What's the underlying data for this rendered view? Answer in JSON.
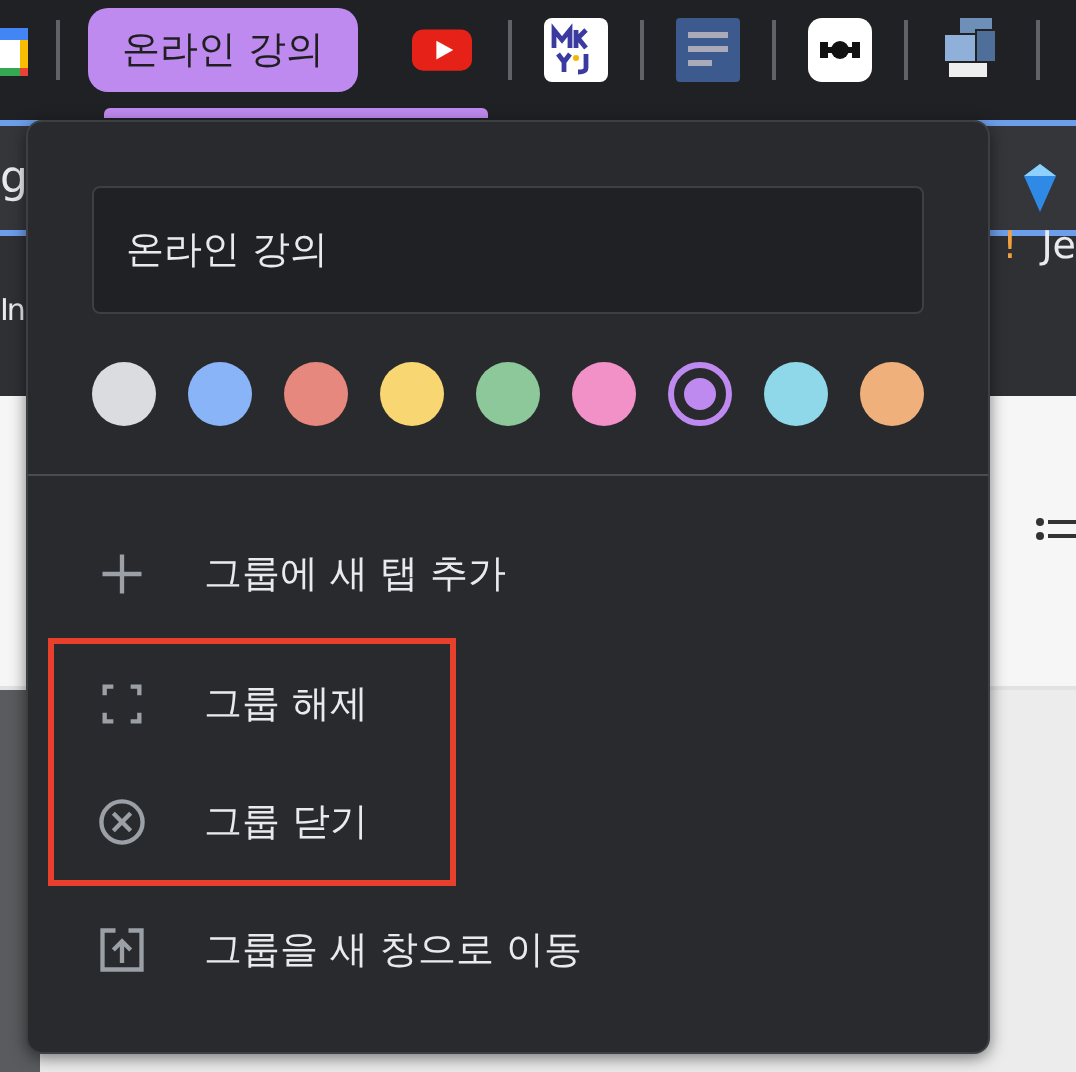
{
  "tab_strip": {
    "group_chip": {
      "label": "온라인 강의",
      "color": "#bf8af0"
    },
    "bookmarks": [
      {
        "kind": "calendar"
      },
      {
        "kind": "youtube"
      },
      {
        "kind": "mkyj"
      },
      {
        "kind": "doc"
      },
      {
        "kind": "ioi"
      },
      {
        "kind": "gif"
      }
    ]
  },
  "background": {
    "tab_fragment": "g",
    "toolbar_fragment_left": "In",
    "toolbar_fragment_right": [
      "!",
      "Je"
    ]
  },
  "group_menu": {
    "name_field": {
      "value": "온라인 강의"
    },
    "colors": [
      {
        "color": "#dadce0",
        "selected": false
      },
      {
        "color": "#8ab4f8",
        "selected": false
      },
      {
        "color": "#e6887e",
        "selected": false
      },
      {
        "color": "#f8d672",
        "selected": false
      },
      {
        "color": "#8cc89a",
        "selected": false
      },
      {
        "color": "#f290c8",
        "selected": false
      },
      {
        "color": "#bf8af0",
        "selected": true
      },
      {
        "color": "#8ed8e9",
        "selected": false
      },
      {
        "color": "#f0b07c",
        "selected": false
      }
    ],
    "items": [
      {
        "kind": "add",
        "label": "그룹에 새 탭 추가",
        "highlighted": false
      },
      {
        "kind": "ungroup",
        "label": "그룹 해제",
        "highlighted": true
      },
      {
        "kind": "close",
        "label": "그룹 닫기",
        "highlighted": true
      },
      {
        "kind": "move",
        "label": "그룹을 새 창으로 이동",
        "highlighted": false
      }
    ]
  }
}
